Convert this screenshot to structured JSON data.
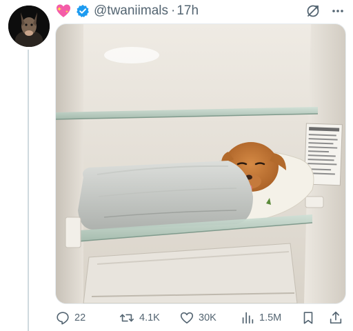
{
  "tweet": {
    "handle": "@twaniimals",
    "separator": "·",
    "time": "17h",
    "image": {
      "subject": "dog-in-fridge"
    }
  },
  "actions": {
    "replies": "22",
    "retweets": "4.1K",
    "likes": "30K",
    "views": "1.5M"
  },
  "colors": {
    "text_secondary": "#536471",
    "verified": "#1d9bf0",
    "border": "#cfd9de"
  },
  "icons": [
    "sparkling-heart-icon",
    "verified-badge-icon",
    "grok-icon",
    "more-icon",
    "reply-icon",
    "retweet-icon",
    "like-icon",
    "views-icon",
    "bookmark-icon",
    "share-icon"
  ]
}
